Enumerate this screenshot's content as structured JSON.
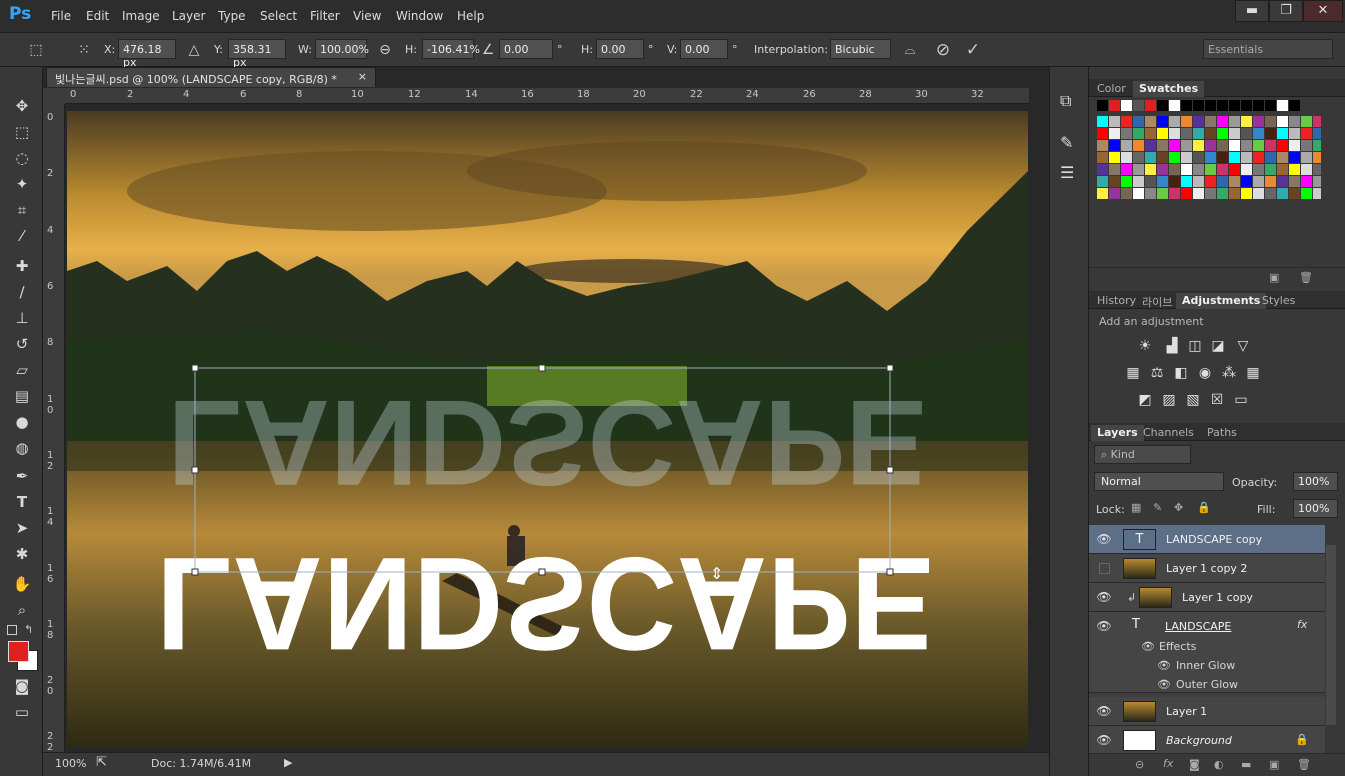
{
  "app": {
    "logo": "Ps"
  },
  "menu": [
    "File",
    "Edit",
    "Image",
    "Layer",
    "Type",
    "Select",
    "Filter",
    "View",
    "Window",
    "Help"
  ],
  "window_controls": {
    "minimize": "▬",
    "maximize": "❐",
    "close": "✕"
  },
  "options": {
    "x_label": "X:",
    "x_value": "476.18 px",
    "y_label": "Y:",
    "y_value": "358.31 px",
    "w_label": "W:",
    "w_value": "100.00%",
    "h_label": "H:",
    "h_value": "-106.41%",
    "angle_value": "0.00",
    "deg": "°",
    "hskew_label": "H:",
    "hskew_value": "0.00",
    "vskew_label": "V:",
    "vskew_value": "0.00",
    "interp_label": "Interpolation:",
    "interp_value": "Bicubic",
    "workspace": "Essentials"
  },
  "document": {
    "tab_title": "빛나는글씨.psd @ 100% (LANDSCAPE copy, RGB/8) *",
    "close": "×"
  },
  "ruler_h": [
    "0",
    "2",
    "4",
    "6",
    "8",
    "10",
    "12",
    "14",
    "16",
    "18",
    "20",
    "22",
    "24",
    "26",
    "28",
    "30",
    "32"
  ],
  "ruler_v": [
    "0",
    "2",
    "4",
    "6",
    "8",
    "1 0",
    "1 2",
    "1 4",
    "1 6",
    "1 8",
    "2 0",
    "2 2"
  ],
  "canvas_text": {
    "top": "LANDSCAPE",
    "bottom": "LANDSCAPE"
  },
  "status": {
    "zoom": "100%",
    "doc": "Doc: 1.74M/6.41M"
  },
  "panels": {
    "color_tabs": [
      "Color",
      "Swatches"
    ],
    "history_tabs": [
      "History",
      "라이브",
      "Adjustments",
      "Styles"
    ],
    "add_adjustment": "Add an adjustment",
    "layers_tabs": [
      "Layers",
      "Channels",
      "Paths"
    ],
    "kind": "Kind",
    "blend": "Normal",
    "opacity_label": "Opacity:",
    "opacity_value": "100%",
    "lock_label": "Lock:",
    "fill_label": "Fill:",
    "fill_value": "100%"
  },
  "layers": [
    {
      "name": "LANDSCAPE copy"
    },
    {
      "name": "Layer 1 copy 2"
    },
    {
      "name": "Layer 1 copy"
    },
    {
      "name": "LANDSCAPE"
    },
    {
      "name": "Effects"
    },
    {
      "name": "Inner Glow"
    },
    {
      "name": "Outer Glow"
    },
    {
      "name": "Layer 1"
    },
    {
      "name": "Background"
    }
  ],
  "colors": {
    "accent": "#31a8ff",
    "foreground": "#e02020",
    "background": "#ffffff",
    "selected_layer": "#5d6e87"
  }
}
